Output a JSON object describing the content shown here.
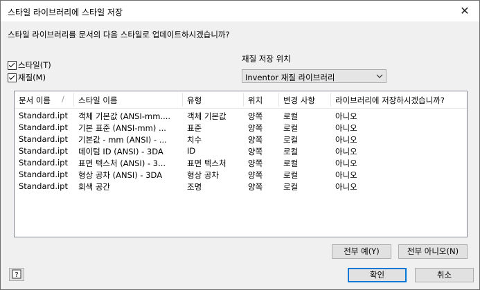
{
  "window": {
    "title": "스타일 라이브러리에 스타일 저장",
    "close_glyph": "✕"
  },
  "prompt": "스타일 라이브러리를 문서의 다음 스타일로 업데이트하시겠습니까?",
  "checkboxes": [
    {
      "label": "스타일(T)",
      "checked": true
    },
    {
      "label": "재질(M)",
      "checked": true
    }
  ],
  "material_location": {
    "label": "재질 저장 위치",
    "value": "Inventor 재질 라이브러리"
  },
  "table": {
    "columns": [
      "문서 이름",
      "스타일 이름",
      "유형",
      "위치",
      "변경 사항",
      "라이브러리에 저장하시겠습니까?"
    ],
    "sort_indicator": "/",
    "rows": [
      [
        "Standard.ipt",
        "객체 기본값 (ANSI-mm....",
        "객체 기본값",
        "양쪽",
        "로컬",
        "아니오"
      ],
      [
        "Standard.ipt",
        "기본 표준 (ANSI-mm) ...",
        "표준",
        "양쪽",
        "로컬",
        "아니오"
      ],
      [
        "Standard.ipt",
        "기본값 - mm (ANSI) - ...",
        "치수",
        "양쪽",
        "로컬",
        "아니오"
      ],
      [
        "Standard.ipt",
        "데이텀 ID (ANSI) - 3DA",
        "ID",
        "양쪽",
        "로컬",
        "아니오"
      ],
      [
        "Standard.ipt",
        "표면 텍스처 (ANSI) - 3...",
        "표면 텍스처",
        "양쪽",
        "로컬",
        "아니오"
      ],
      [
        "Standard.ipt",
        "형상 공차 (ANSI) - 3DA",
        "형상 공차",
        "양쪽",
        "로컬",
        "아니오"
      ],
      [
        "Standard.ipt",
        "회색 공간",
        "조명",
        "양쪽",
        "로컬",
        "아니오"
      ]
    ]
  },
  "buttons": {
    "all_yes": "전부 예(Y)",
    "all_no": "전부 아니오(N)",
    "ok": "확인",
    "cancel": "취소",
    "help": "?"
  }
}
